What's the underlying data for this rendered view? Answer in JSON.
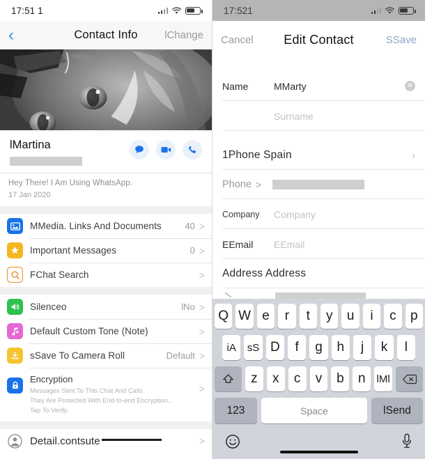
{
  "left": {
    "status": {
      "time": "17:51 1",
      "signal_icon": "cellular-signal-icon",
      "wifi_icon": "wifi-icon",
      "battery_icon": "battery-icon"
    },
    "nav": {
      "back_icon": "back-chevron-icon",
      "title": "Contact Info",
      "right_action": "lChange"
    },
    "photo": {
      "alt": "contact-photo-cat"
    },
    "contact": {
      "name": "lMartina",
      "redacted_number": "",
      "actions": [
        {
          "name": "message-action",
          "icon": "chat-bubble-icon"
        },
        {
          "name": "video-call-action",
          "icon": "video-camera-icon"
        },
        {
          "name": "voice-call-action",
          "icon": "phone-handset-icon"
        }
      ]
    },
    "about": {
      "status_text": "Hey There! I Am Using WhatsApp.",
      "date": "17 Jan 2020"
    },
    "groups": [
      {
        "rows": [
          {
            "icon": "media-photo-icon",
            "color": "#1b72e8",
            "label": "MMedia. Links And Documents",
            "value": "40",
            "chevron": ">"
          },
          {
            "icon": "star-icon",
            "color": "#f5b721",
            "label": "Important Messages",
            "value": "0",
            "chevron": ">"
          },
          {
            "icon": "search-magnifier-icon",
            "color": "#f08a24",
            "label": "FChat Search",
            "value": "",
            "chevron": ">"
          }
        ]
      },
      {
        "rows": [
          {
            "icon": "speaker-mute-icon",
            "color": "#2ec14e",
            "label": "Silenceo",
            "value": "lNo",
            "chevron": ">"
          },
          {
            "icon": "music-note-icon",
            "color": "#e667d4",
            "label": "Default Custom Tone (Note)",
            "value": "",
            "chevron": ">"
          },
          {
            "icon": "save-download-icon",
            "color": "#f5c431",
            "label": "sSave To Camera Roll",
            "value": "Default",
            "chevron": ">"
          },
          {
            "icon": "lock-icon",
            "color": "#1b72e8",
            "label": "Encryption",
            "sub1": "Messages Sent To This Chat And Calls",
            "sub2": "They Are Protected With End-to-end Encryption...",
            "sub3": "Tap  To Verify.",
            "chevron": ">"
          }
        ]
      },
      {
        "rows": [
          {
            "icon": "person-circle-icon",
            "color": "#8e8e93",
            "label": "Detail.contsute",
            "value": "",
            "chevron": ">"
          }
        ]
      }
    ]
  },
  "right": {
    "status": {
      "time": "17:521",
      "signal_icon": "cellular-signal-icon",
      "wifi_icon": "wifi-icon",
      "battery_icon": "battery-icon"
    },
    "nav": {
      "cancel": "Cancel",
      "title": "Edit Contact",
      "save": "SSave"
    },
    "fields": {
      "name_label": "Name",
      "name_value": "MMarty",
      "clear_icon": "clear-circle-icon",
      "surname_placeholder": "Surname",
      "phone_country_row": "1Phone Spain",
      "phone_label": "Phone",
      "phone_arrow": ">",
      "company_label": "Company",
      "company_placeholder": "Company",
      "email_label": "EEmail",
      "email_placeholder": "EEmail",
      "address_row": "Address Address"
    },
    "keyboard": {
      "row1": [
        "Q",
        "W",
        "e",
        "r",
        "t",
        "y",
        "u",
        "i",
        "c",
        "p"
      ],
      "row2": [
        "iA",
        "sS",
        "D",
        "f",
        "g",
        "h",
        "j",
        "k",
        "l"
      ],
      "shift_icon": "shift-up-arrow-icon",
      "row3": [
        "z",
        "x",
        "c",
        "v",
        "b",
        "n",
        "lMl"
      ],
      "backspace_icon": "backspace-delete-icon",
      "numbers_key": "123",
      "space_key": "Space",
      "send_key": "lSend",
      "emoji_icon": "smiley-emoji-icon",
      "mic_icon": "microphone-icon"
    }
  }
}
